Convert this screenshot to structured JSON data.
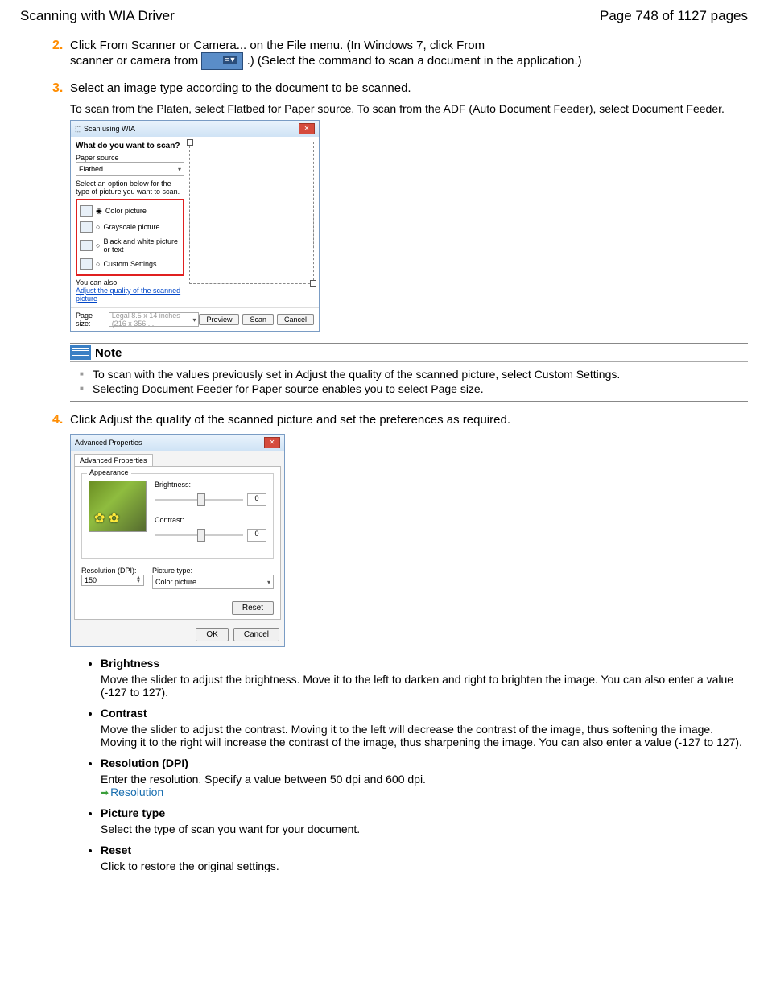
{
  "header": {
    "title": "Scanning with WIA Driver",
    "page": "Page 748 of 1127 pages"
  },
  "step2": {
    "num": "2.",
    "line1a": "Click From Scanner or Camera... on the File menu. (In Windows 7, click From",
    "line1b_before": "scanner or camera from ",
    "line1b_after": ".) (Select the command to scan a document in the application.)"
  },
  "step3": {
    "num": "3.",
    "text": "Select an image type according to the document to be scanned.",
    "sub": "To scan from the Platen, select Flatbed for Paper source. To scan from the ADF (Auto Document Feeder), select Document Feeder."
  },
  "wia": {
    "title": "Scan using WIA",
    "q": "What do you want to scan?",
    "paper_label": "Paper source",
    "paper_value": "Flatbed",
    "hint": "Select an option below for the type of picture you want to scan.",
    "opts": [
      "Color picture",
      "Grayscale picture",
      "Black and white picture or text",
      "Custom Settings"
    ],
    "also": "You can also:",
    "adjust_link": "Adjust the quality of the scanned picture",
    "page_size_label": "Page size:",
    "page_size_value": "Legal 8.5 x 14 inches (216 x 356 ...",
    "preview_btn": "Preview",
    "scan_btn": "Scan",
    "cancel_btn": "Cancel"
  },
  "note": {
    "head": "Note",
    "items": [
      "To scan with the values previously set in Adjust the quality of the scanned picture, select Custom Settings.",
      "Selecting Document Feeder for Paper source enables you to select Page size."
    ]
  },
  "step4": {
    "num": "4.",
    "text": "Click Adjust the quality of the scanned picture and set the preferences as required."
  },
  "adv": {
    "title": "Advanced Properties",
    "tab": "Advanced Properties",
    "appearance": "Appearance",
    "brightness": "Brightness:",
    "brightness_val": "0",
    "contrast": "Contrast:",
    "contrast_val": "0",
    "res_label": "Resolution (DPI):",
    "res_val": "150",
    "pic_label": "Picture type:",
    "pic_val": "Color picture",
    "reset": "Reset",
    "ok": "OK",
    "cancel": "Cancel"
  },
  "desc": {
    "items": [
      {
        "h": "Brightness",
        "d": "Move the slider to adjust the brightness. Move it to the left to darken and right to brighten the image. You can also enter a value (-127 to 127)."
      },
      {
        "h": "Contrast",
        "d": "Move the slider to adjust the contrast. Moving it to the left will decrease the contrast of the image, thus softening the image. Moving it to the right will increase the contrast of the image, thus sharpening the image. You can also enter a value (-127 to 127)."
      },
      {
        "h": "Resolution (DPI)",
        "d": "Enter the resolution. Specify a value between 50 dpi and 600 dpi.",
        "link": "Resolution"
      },
      {
        "h": "Picture type",
        "d": "Select the type of scan you want for your document."
      },
      {
        "h": "Reset",
        "d": "Click to restore the original settings."
      }
    ]
  }
}
